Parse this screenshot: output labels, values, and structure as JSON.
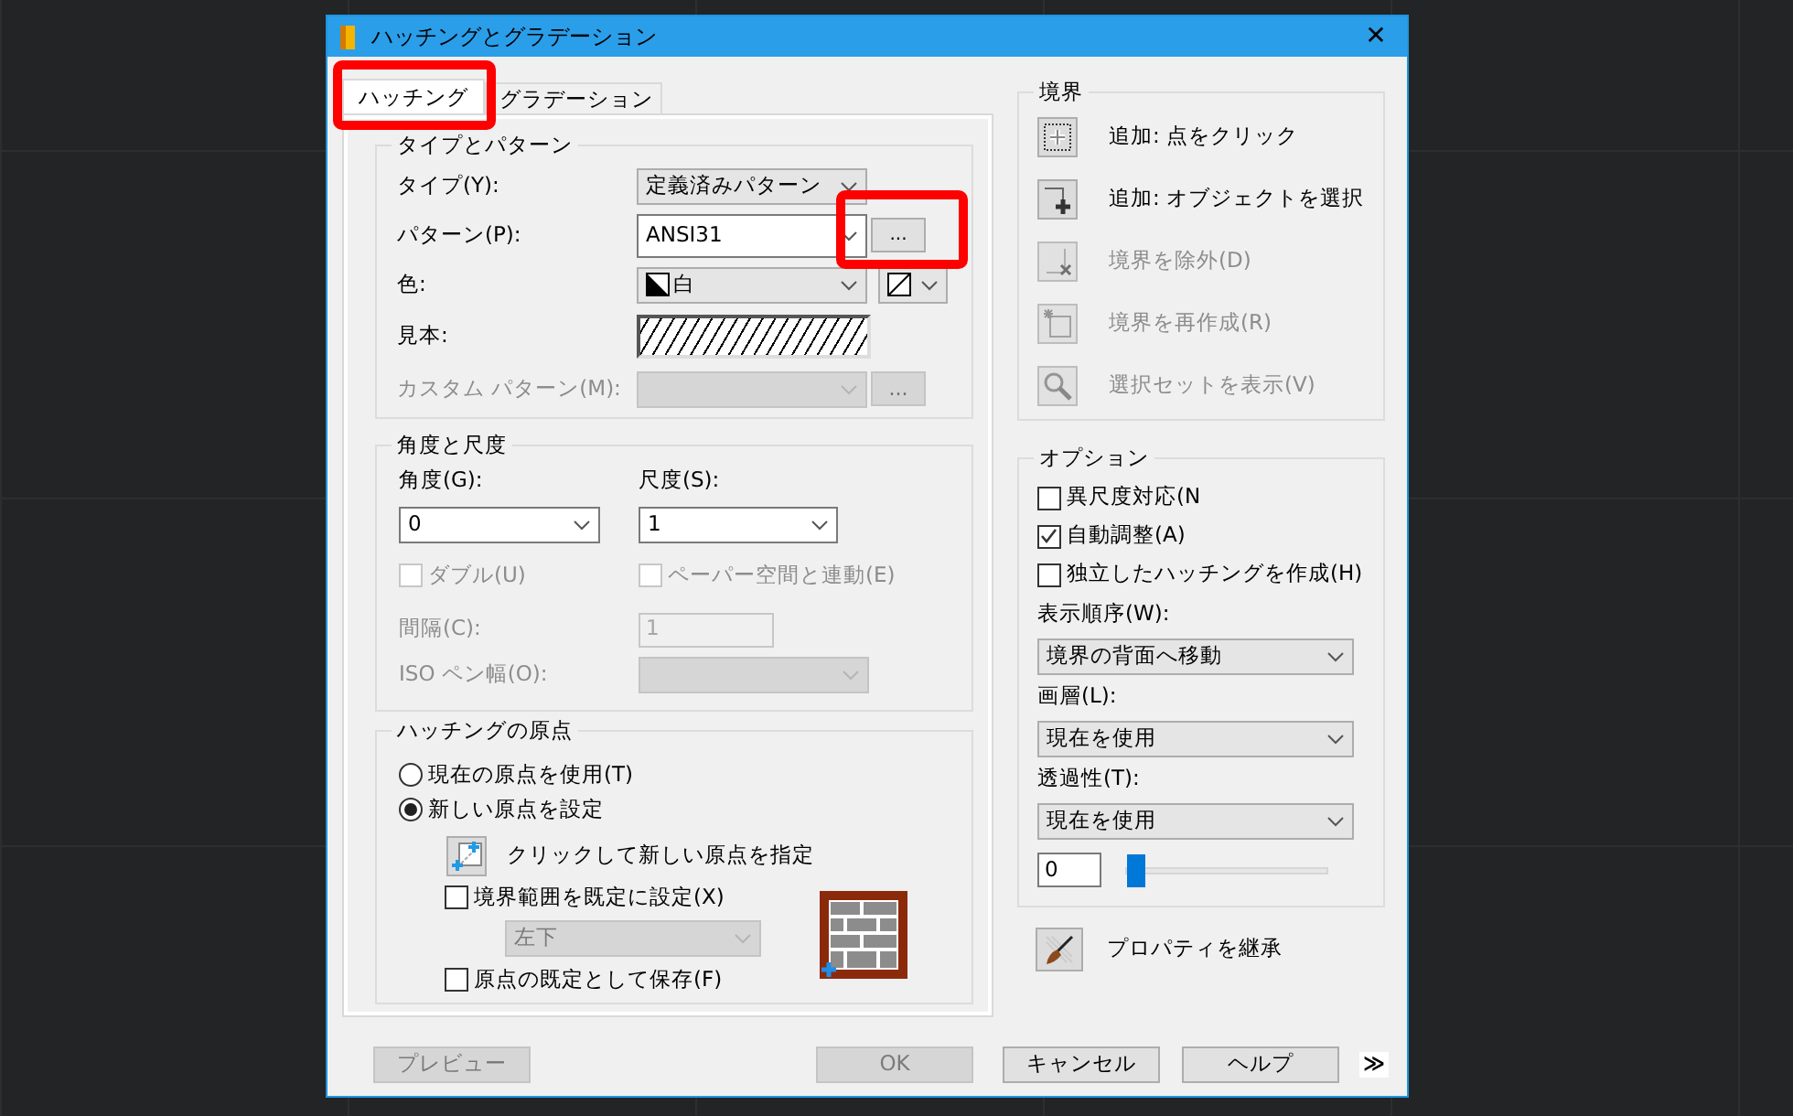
{
  "window": {
    "title": "ハッチングとグラデーション",
    "close": "✕"
  },
  "tabs": [
    {
      "label": "ハッチング",
      "selected": true,
      "highlighted": true
    },
    {
      "label": "グラデーション",
      "selected": false,
      "highlighted": false
    }
  ],
  "type_and_pattern": {
    "title": "タイプとパターン",
    "rows": [
      {
        "kind": "select",
        "label": "タイプ(Y):",
        "value": "定義済みパターン",
        "disabled": false
      },
      {
        "kind": "combo",
        "label": "パターン(P):",
        "value": "ANSI31",
        "button": "...",
        "button_highlighted": true,
        "disabled": false
      },
      {
        "kind": "color",
        "label": "色:",
        "value": "白",
        "disabled": false
      },
      {
        "kind": "swatch",
        "label": "見本:"
      },
      {
        "kind": "select",
        "label": "カスタム パターン(M):",
        "button": "...",
        "disabled": true
      }
    ]
  },
  "angle_and_scale": {
    "title": "角度と尺度",
    "angle": {
      "label": "角度(G):",
      "value": "0"
    },
    "scale": {
      "label": "尺度(S):",
      "value": "1"
    },
    "double": {
      "label": "ダブル(U)",
      "checked": false,
      "disabled": true
    },
    "paper_space": {
      "label": "ペーパー空間と連動(E)",
      "checked": false,
      "disabled": true
    },
    "spacing": {
      "label": "間隔(C):",
      "value": "1",
      "disabled": true
    },
    "iso_pen": {
      "label": "ISO ペン幅(O):",
      "disabled": true
    }
  },
  "origin": {
    "title": "ハッチングの原点",
    "options": [
      {
        "label": "現在の原点を使用(T)",
        "selected": false
      },
      {
        "label": "新しい原点を設定",
        "selected": true
      }
    ],
    "pick": {
      "label": "クリックして新しい原点を指定"
    },
    "bounds": {
      "label": "境界範囲を既定に設定(X)",
      "checked": false
    },
    "position": {
      "value": "左下",
      "disabled": true
    },
    "save": {
      "label": "原点の既定として保存(F)",
      "checked": false
    }
  },
  "boundaries": {
    "title": "境界",
    "actions": [
      {
        "kind": "pick-point",
        "label": "追加: 点をクリック",
        "disabled": false
      },
      {
        "kind": "select-object",
        "label": "追加: オブジェクトを選択",
        "disabled": false
      },
      {
        "kind": "remove",
        "label": "境界を除外(D)",
        "disabled": true
      },
      {
        "kind": "recreate",
        "label": "境界を再作成(R)",
        "disabled": true
      },
      {
        "kind": "view",
        "label": "選択セットを表示(V)",
        "disabled": true
      }
    ]
  },
  "options": {
    "title": "オプション",
    "checks": [
      {
        "label": "異尺度対応(N",
        "checked": false
      },
      {
        "label": "自動調整(A)",
        "checked": true
      },
      {
        "label": "独立したハッチングを作成(H)",
        "checked": false
      }
    ],
    "selects": [
      {
        "label": "表示順序(W):",
        "value": "境界の背面へ移動"
      },
      {
        "label": "画層(L):",
        "value": "現在を使用"
      },
      {
        "label": "透過性(T):",
        "value": "現在を使用"
      }
    ],
    "transparency": {
      "value": "0",
      "level": 0
    }
  },
  "inherit": {
    "label": "プロパティを継承"
  },
  "buttons": [
    {
      "label": "プレビュー",
      "disabled": true
    },
    {
      "label": "OK",
      "disabled": true
    },
    {
      "label": "キャンセル",
      "disabled": false
    },
    {
      "label": "ヘルプ",
      "disabled": false
    }
  ],
  "expand": "≫"
}
